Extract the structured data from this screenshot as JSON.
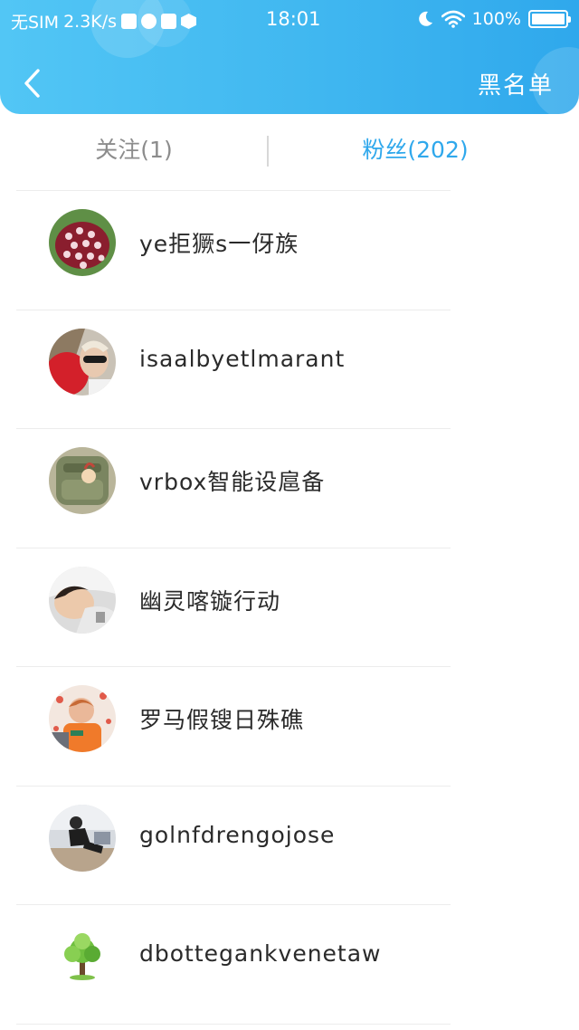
{
  "status_bar": {
    "carrier": "无SIM",
    "speed": "2.3K/s",
    "time": "18:01",
    "battery_text": "100%",
    "battery_level": 1.0,
    "icons": [
      "check-box-icon",
      "app-icon",
      "mail-icon",
      "hex-app-icon",
      "moon-icon",
      "wifi-icon",
      "battery-icon"
    ]
  },
  "header": {
    "back_icon": "chevron-left-icon",
    "blacklist_label": "黑名单",
    "colors": {
      "gradient_start": "#52c6f5",
      "gradient_end": "#2fa8ec"
    }
  },
  "tabs": {
    "following_label": "关注(1)",
    "fans_label": "粉丝(202)",
    "active": "fans",
    "colors": {
      "active": "#2fa8ec",
      "inactive": "#8c8c8c"
    }
  },
  "fans": [
    {
      "name": "ye拒獗s一伢族",
      "avatar": "flower-avatar"
    },
    {
      "name": "isaalbyetlmarant",
      "avatar": "sunglasses-avatar"
    },
    {
      "name": "vrbox智能设扈备",
      "avatar": "bag-avatar"
    },
    {
      "name": "幽灵喀镟行动",
      "avatar": "sleeping-child-avatar"
    },
    {
      "name": "罗马假锼日殊礁",
      "avatar": "child-orange-avatar"
    },
    {
      "name": "golnfdrengojose",
      "avatar": "person-sitting-avatar"
    },
    {
      "name": "dbottegankvenetaw",
      "avatar": "tree-avatar"
    }
  ]
}
